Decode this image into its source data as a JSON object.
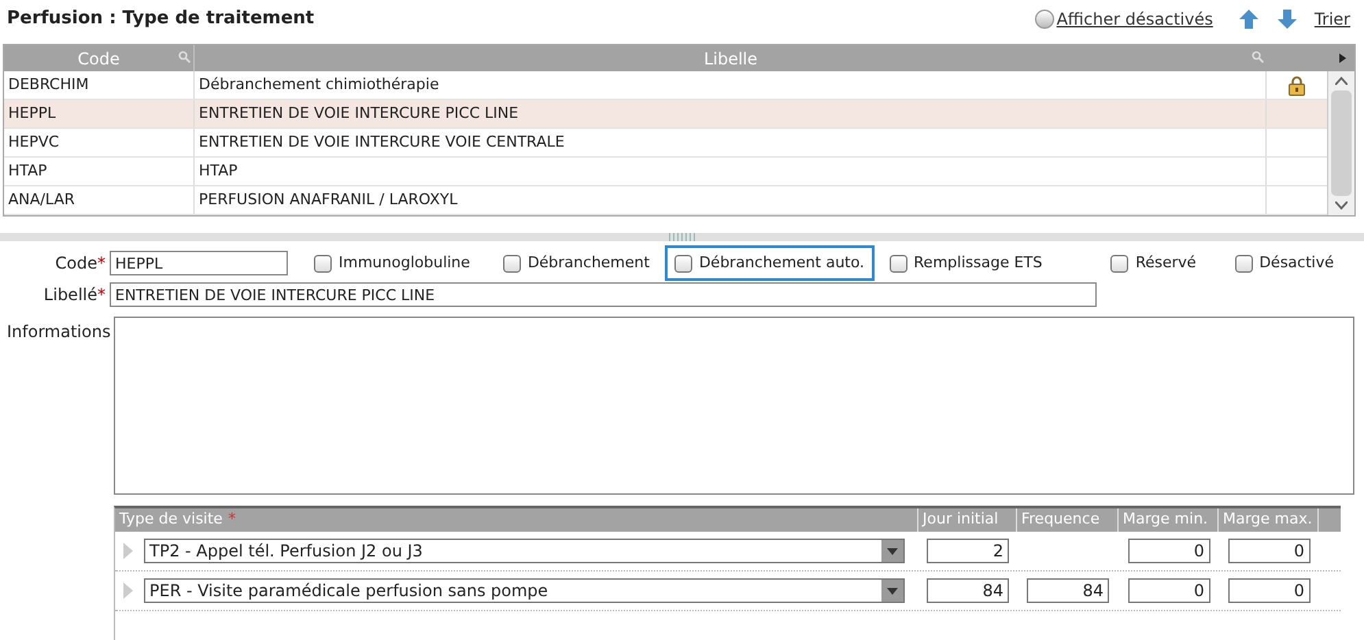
{
  "title": "Perfusion : Type de traitement",
  "toolbar": {
    "show_disabled": {
      "label": "Afficher désactivés",
      "on": false
    },
    "sort": "Trier"
  },
  "table": {
    "columns": [
      "Code",
      "Libelle"
    ],
    "rows": [
      {
        "code": "DEBRCHIM",
        "libelle": "Débranchement chimiothérapie",
        "locked": true,
        "selected": false
      },
      {
        "code": "HEPPL",
        "libelle": "ENTRETIEN DE VOIE INTERCURE PICC LINE",
        "locked": false,
        "selected": true
      },
      {
        "code": "HEPVC",
        "libelle": "ENTRETIEN DE VOIE INTERCURE VOIE CENTRALE",
        "locked": false,
        "selected": false
      },
      {
        "code": "HTAP",
        "libelle": "HTAP",
        "locked": false,
        "selected": false
      },
      {
        "code": "ANA/LAR",
        "libelle": "PERFUSION ANAFRANIL / LAROXYL",
        "locked": false,
        "selected": false
      }
    ]
  },
  "form": {
    "code": {
      "label": "Code",
      "required_mark": "*",
      "value": "HEPPL"
    },
    "libelle": {
      "label": "Libellé",
      "required_mark": "*",
      "value": "ENTRETIEN DE VOIE INTERCURE PICC LINE"
    },
    "informations": {
      "label": "Informations"
    },
    "checkboxes": [
      {
        "label": "Immunoglobuline",
        "checked": false,
        "focused": false
      },
      {
        "label": "Débranchement",
        "checked": false,
        "focused": false
      },
      {
        "label": "Débranchement auto.",
        "checked": false,
        "focused": true
      },
      {
        "label": "Remplissage ETS",
        "checked": false,
        "focused": false
      },
      {
        "label": "Réservé",
        "checked": false,
        "focused": false
      },
      {
        "label": "Désactivé",
        "checked": false,
        "focused": false
      }
    ]
  },
  "visits": {
    "columns": [
      {
        "label": "Type de visite",
        "required_mark": "*"
      },
      {
        "label": "Jour initial"
      },
      {
        "label": "Frequence"
      },
      {
        "label": "Marge min."
      },
      {
        "label": "Marge max."
      }
    ],
    "rows": [
      {
        "type": "TP2 - Appel tél. Perfusion J2 ou J3",
        "jour_initial": "2",
        "marge_min": "0",
        "marge_max": "0"
      },
      {
        "type": "PER - Visite paramédicale perfusion sans pompe",
        "jour_initial": "84",
        "frequence": "84",
        "marge_min": "0",
        "marge_max": "0"
      }
    ]
  }
}
